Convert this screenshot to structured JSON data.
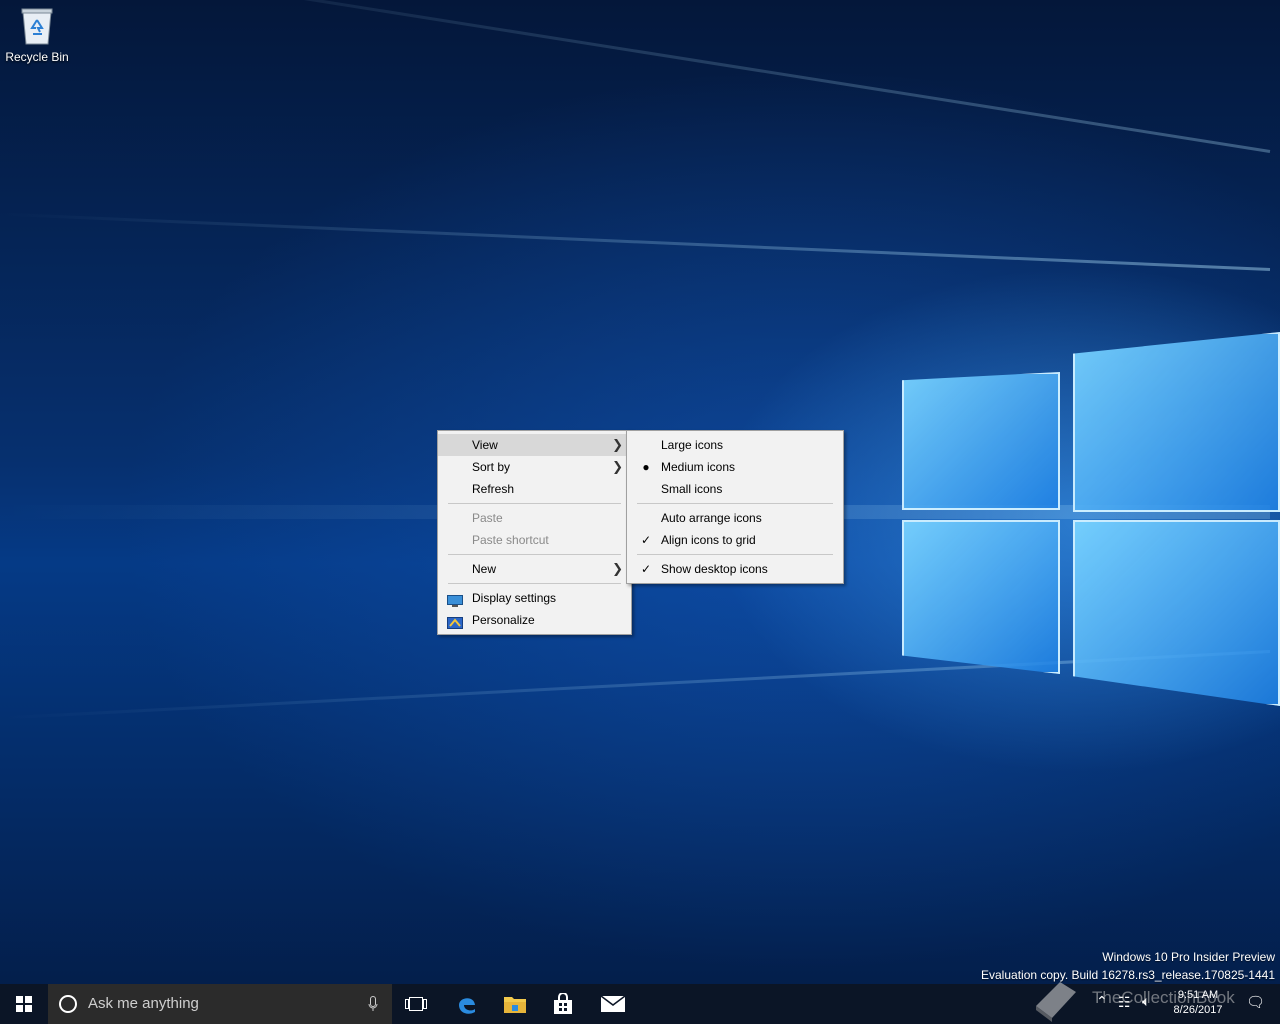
{
  "desktop": {
    "icons": [
      {
        "label": "Recycle Bin",
        "icon": "recycle-bin-icon"
      }
    ],
    "watermark": {
      "line1": "Windows 10 Pro Insider Preview",
      "line2": "Evaluation copy. Build 16278.rs3_release.170825-1441"
    }
  },
  "context_menu": {
    "view": "View",
    "sort_by": "Sort by",
    "refresh": "Refresh",
    "paste": "Paste",
    "paste_shortcut": "Paste shortcut",
    "new": "New",
    "display_settings": "Display settings",
    "personalize": "Personalize"
  },
  "view_submenu": {
    "large_icons": "Large icons",
    "medium_icons": "Medium icons",
    "small_icons": "Small icons",
    "auto_arrange": "Auto arrange icons",
    "align_to_grid": "Align icons to grid",
    "show_desktop_icons": "Show desktop icons",
    "selected_size": "Medium icons",
    "checked": [
      "Align icons to grid",
      "Show desktop icons"
    ]
  },
  "taskbar": {
    "search_placeholder": "Ask me anything",
    "pinned": [
      "edge-icon",
      "file-explorer-icon",
      "store-icon",
      "mail-icon"
    ],
    "clock_time": "9:51 AM",
    "clock_date": "8/26/2017",
    "overlay_text": "TheCollectionBook"
  },
  "colors": {
    "menu_bg": "#f2f2f2",
    "menu_highlight": "#d8d8d8",
    "taskbar_bg": "#0b1526",
    "search_bg": "#2b2b2b"
  }
}
